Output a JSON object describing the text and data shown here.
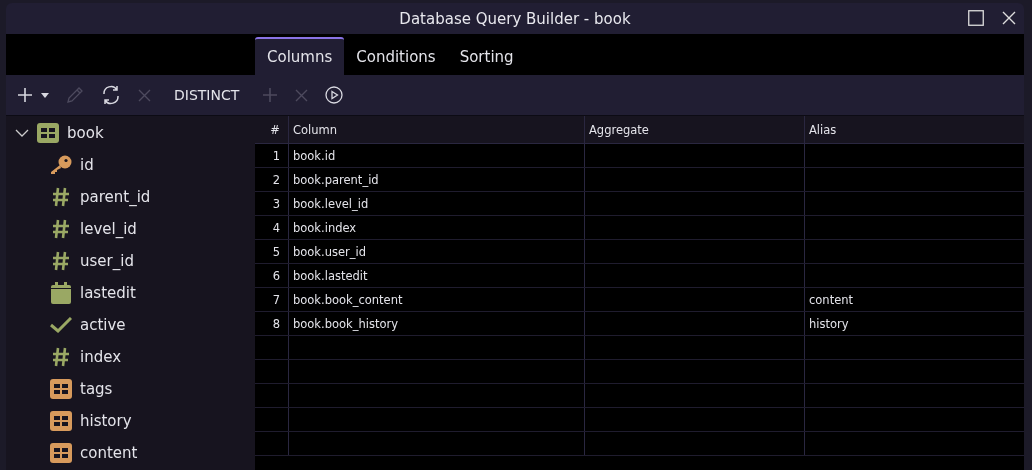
{
  "window": {
    "title": "Database Query Builder - book"
  },
  "tabs": [
    {
      "label": "Columns",
      "selected": true
    },
    {
      "label": "Conditions",
      "selected": false
    },
    {
      "label": "Sorting",
      "selected": false
    }
  ],
  "toolbar": [
    {
      "kind": "add",
      "disabled": false
    },
    {
      "kind": "dropdown",
      "disabled": false
    },
    {
      "kind": "edit",
      "disabled": true
    },
    {
      "kind": "refresh",
      "disabled": false
    },
    {
      "kind": "delete",
      "disabled": true
    },
    {
      "kind": "text",
      "label": "DISTINCT",
      "disabled": false
    },
    {
      "kind": "add",
      "disabled": true
    },
    {
      "kind": "delete",
      "disabled": true
    },
    {
      "kind": "run",
      "disabled": false
    }
  ],
  "tree": [
    {
      "label": "book",
      "kind": "table",
      "expanded": true,
      "children": [
        {
          "label": "id",
          "kind": "key"
        },
        {
          "label": "parent_id",
          "kind": "number"
        },
        {
          "label": "level_id",
          "kind": "number"
        },
        {
          "label": "user_id",
          "kind": "number"
        },
        {
          "label": "lastedit",
          "kind": "date"
        },
        {
          "label": "active",
          "kind": "boolean"
        },
        {
          "label": "index",
          "kind": "number"
        },
        {
          "label": "tags",
          "kind": "object"
        },
        {
          "label": "history",
          "kind": "object"
        },
        {
          "label": "content",
          "kind": "object"
        }
      ]
    }
  ],
  "table": {
    "columns": [
      "#",
      "Column",
      "Aggregate",
      "Alias"
    ],
    "rows": [
      {
        "num": "1",
        "column": "book.id"
      },
      {
        "num": "2",
        "column": "book.parent_id"
      },
      {
        "num": "3",
        "column": "book.level_id"
      },
      {
        "num": "4",
        "column": "book.index"
      },
      {
        "num": "5",
        "column": "book.user_id"
      },
      {
        "num": "6",
        "column": "book.lastedit"
      },
      {
        "num": "7",
        "column": "book.book_content",
        "alias": "content"
      },
      {
        "num": "8",
        "column": "book.book_history",
        "alias": "history"
      }
    ]
  }
}
